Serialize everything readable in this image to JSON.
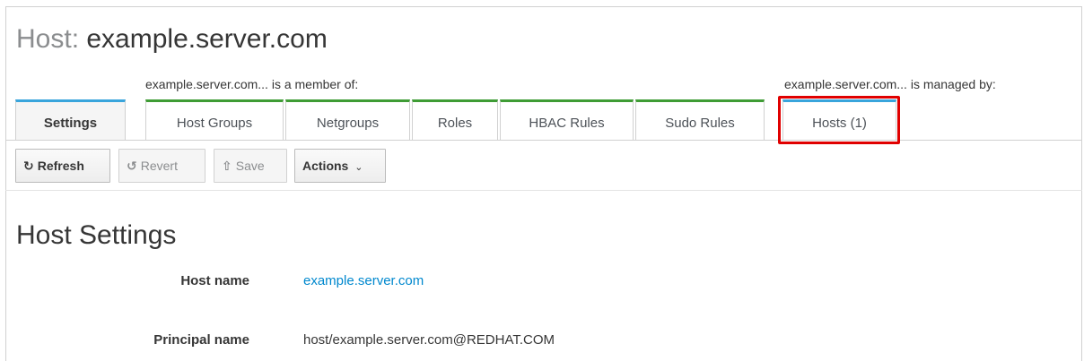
{
  "header": {
    "kind": "Host",
    "separator": ":",
    "name": "example.server.com"
  },
  "tabs": {
    "member_of_label": "example.server.com... is a member of:",
    "managed_by_label": "example.server.com... is managed by:",
    "settings": "Settings",
    "host_groups": "Host Groups",
    "netgroups": "Netgroups",
    "roles": "Roles",
    "hbac_rules": "HBAC Rules",
    "sudo_rules": "Sudo Rules",
    "hosts": "Hosts (1)"
  },
  "toolbar": {
    "refresh": "Refresh",
    "revert": "Revert",
    "save": "Save",
    "actions": "Actions"
  },
  "section": {
    "title": "Host Settings",
    "host_name_label": "Host name",
    "host_name_value": "example.server.com",
    "principal_label": "Principal name",
    "principal_value": "host/example.server.com@REDHAT.COM"
  },
  "colors": {
    "blue_accent": "#39a5dc",
    "green_accent": "#3f9c35",
    "highlight": "#e00000",
    "link": "#0088ce"
  }
}
